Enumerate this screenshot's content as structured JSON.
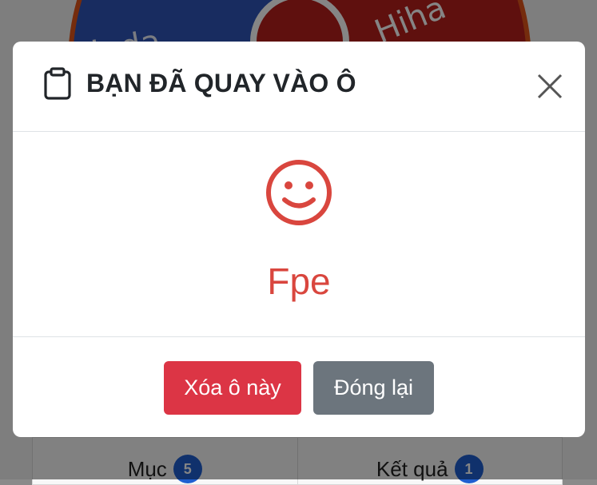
{
  "background": {
    "wheel_labels": [
      "Iuda",
      "Hiha"
    ],
    "tabs": [
      {
        "label": "Mục",
        "count": "5"
      },
      {
        "label": "Kết quả",
        "count": "1"
      }
    ]
  },
  "modal": {
    "title": "BẠN ĐÃ QUAY VÀO Ô",
    "result": "Fpe",
    "buttons": {
      "delete_label": "Xóa ô này",
      "close_label": "Đóng lại"
    }
  },
  "colors": {
    "danger": "#dc3545",
    "secondary": "#6c757d",
    "result_text": "#d9463e",
    "badge": "#1f5fd0"
  },
  "icons": {
    "header": "clipboard-icon",
    "close": "close-icon",
    "result": "smile-icon"
  }
}
